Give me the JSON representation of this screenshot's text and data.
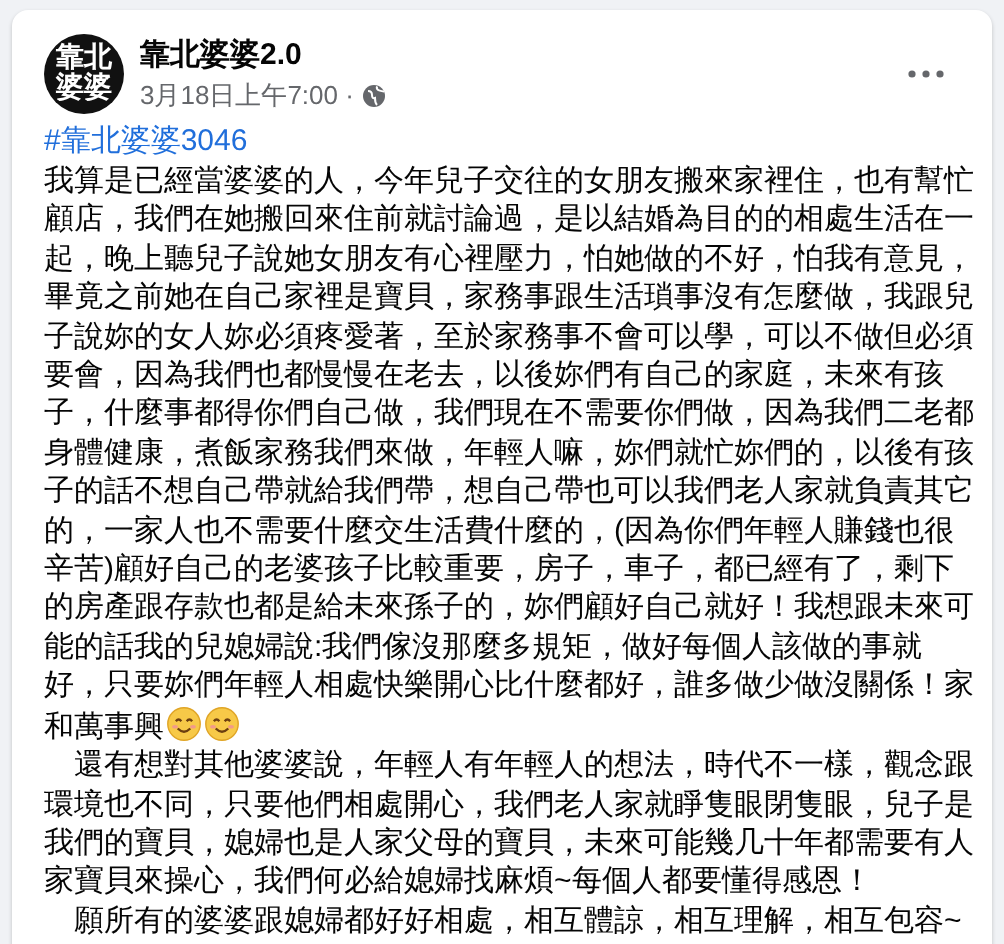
{
  "post": {
    "author": "靠北婆婆2.0",
    "avatar_text": "靠北婆婆",
    "timestamp": "3月18日上午7:00 ·",
    "hashtag": "#靠北婆婆3046",
    "paragraphs": [
      {
        "text": "我算是已經當婆婆的人，今年兒子交往的女朋友搬來家裡住，也有幫忙顧店，我們在她搬回來住前就討論過，是以結婚為目的的相處生活在一起，晚上聽兒子說她女朋友有心裡壓力，怕她做的不好，怕我有意見，畢竟之前她在自己家裡是寶貝，家務事跟生活瑣事沒有怎麼做，我跟兒子說妳的女人妳必須疼愛著，至於家務事不會可以學，可以不做但必須要會，因為我們也都慢慢在老去，以後妳們有自己的家庭，未來有孩子，什麼事都得你們自己做，我們現在不需要你們做，因為我們二老都身體健康，煮飯家務我們來做，年輕人嘛，妳們就忙妳們的，以後有孩子的話不想自己帶就給我們帶，想自己帶也可以我們老人家就負責其它的，一家人也不需要什麼交生活費什麼的，(因為你們年輕人賺錢也很辛苦)顧好自己的老婆孩子比較重要，房子，車子，都已經有了，剩下的房產跟存款也都是給未來孫子的，妳們顧好自己就好！我想跟未來可能的話我的兒媳婦說:我們傢沒那麼多規矩，做好每個人該做的事就好，只要妳們年輕人相處快樂開心比什麼都好，誰多做少做沒關係！家和萬事興",
        "indented": false,
        "ends_with_emoji": true
      },
      {
        "text": "還有想對其他婆婆說，年輕人有年輕人的想法，時代不一樣，觀念跟環境也不同，只要他們相處開心，我們老人家就睜隻眼閉隻眼，兒子是我們的寶貝，媳婦也是人家父母的寶貝，未來可能幾几十年都需要有人家寶貝來操心，我們何必給媳婦找麻煩~每個人都要懂得感恩！",
        "indented": true,
        "ends_with_emoji": false
      },
      {
        "text": "願所有的婆婆跟媳婦都好好相處，相互體諒，相互理解，相互包容~",
        "indented": true,
        "ends_with_emoji": false
      }
    ]
  }
}
